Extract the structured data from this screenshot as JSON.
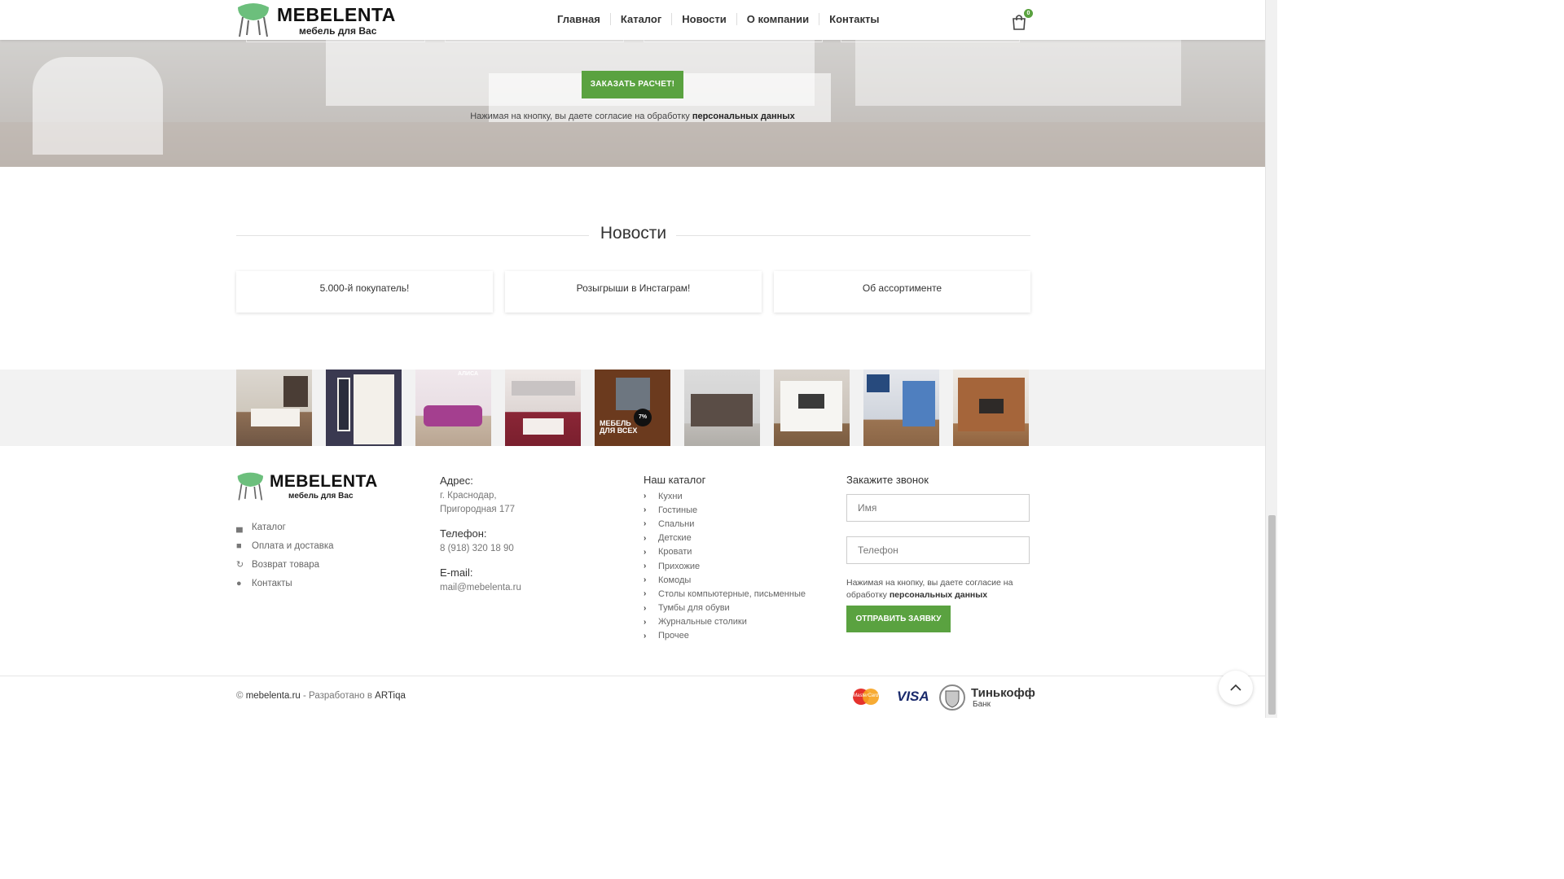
{
  "brand": {
    "name": "MEBELENTA",
    "tagline": "мебель для Вас",
    "accent": "#5aa240"
  },
  "nav": {
    "items": [
      "Главная",
      "Каталог",
      "Новости",
      "О компании",
      "Контакты"
    ]
  },
  "cart": {
    "count": "0",
    "icon": "shopping-bag-icon"
  },
  "hero": {
    "order_button": "ЗАКАЗАТЬ РАСЧЕТ!",
    "consent_prefix": "Нажимая на кнопку, вы даете согласие на обработку ",
    "consent_link": "персональных данных"
  },
  "news": {
    "title": "Новости",
    "items": [
      "5.000-й покупатель!",
      "Розыгрыши в Инстаграм!",
      "Об ассортименте"
    ]
  },
  "gallery": {
    "thumb_labels": [
      "АЛИСА",
      "МЕБЕЛЬ ДЛЯ ВСЕХ",
      "7%"
    ]
  },
  "footer": {
    "links": [
      {
        "label": "Каталог",
        "icon": "shopping-bag-icon"
      },
      {
        "label": "Оплата и доставка",
        "icon": "truck-icon"
      },
      {
        "label": "Возврат товара",
        "icon": "refresh-icon"
      },
      {
        "label": "Контакты",
        "icon": "map-marker-icon"
      }
    ],
    "address_heading": "Адрес:",
    "address_line1": "г. Краснодар,",
    "address_line2": "Пригородная 177",
    "phone_heading": "Телефон:",
    "phone": "8 (918) 320 18 90",
    "email_heading": "E-mail:",
    "email": "mail@mebelenta.ru",
    "catalog_heading": "Наш каталог",
    "catalog_items": [
      "Кухни",
      "Гостиные",
      "Спальни",
      "Детские",
      "Кровати",
      "Прихожие",
      "Комоды",
      "Столы компьютерные, письменные",
      "Тумбы для обуви",
      "Журнальные столики",
      "Прочее"
    ],
    "call_heading": "Закажите звонок",
    "name_placeholder": "Имя",
    "phone_placeholder": "Телефон",
    "call_consent_prefix": "Нажимая на кнопку, вы даете согласие на обработку ",
    "call_consent_link": "персональных данных",
    "submit_button": "ОТПРАВИТЬ ЗАЯВКУ"
  },
  "bottom": {
    "copyright_symbol": "©",
    "site": "mebelenta.ru",
    "dev_text": " - Разработано в ",
    "dev_name": "ARTiqa",
    "payments": [
      "MasterCard",
      "VISA",
      "Тинькофф",
      "Банк"
    ]
  }
}
